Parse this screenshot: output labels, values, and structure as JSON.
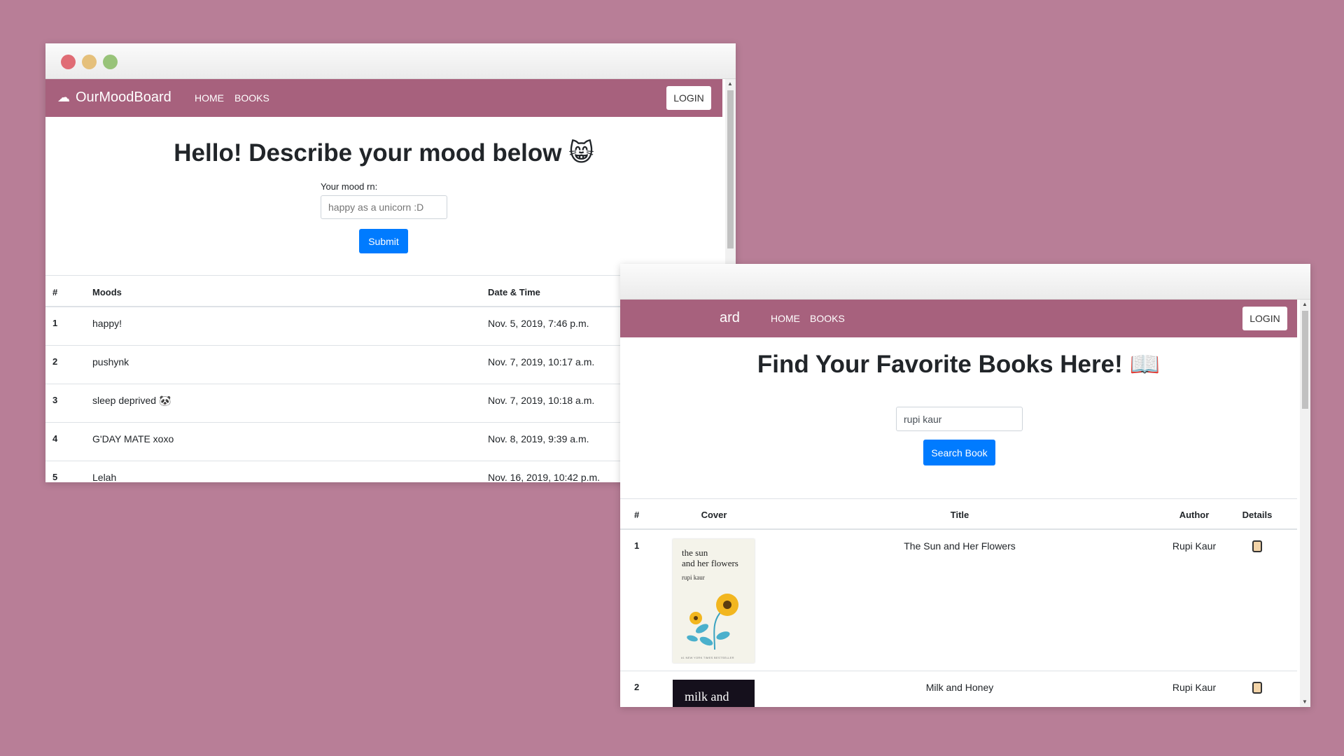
{
  "colors": {
    "background": "#b87e97",
    "navbar": "#a7617d",
    "primary": "#007bff",
    "close": "#e06c75",
    "minimize": "#e5c07b",
    "maximize": "#98c379"
  },
  "mood_window": {
    "brand_icon": "cloud-icon",
    "brand": "OurMoodBoard",
    "nav": {
      "home": "HOME",
      "books": "BOOKS"
    },
    "login": "LOGIN",
    "heading": "Hello! Describe your mood below",
    "heading_emoji": "😸",
    "form_label": "Your mood rn:",
    "input_placeholder": "happy as a unicorn :D",
    "submit": "Submit",
    "columns": {
      "num": "#",
      "moods": "Moods",
      "datetime": "Date & Time"
    },
    "rows": [
      {
        "num": "1",
        "mood": "happy!",
        "datetime": "Nov. 5, 2019, 7:46 p.m.",
        "action_icon": "sparkle-icon"
      },
      {
        "num": "2",
        "mood": "pushynk",
        "datetime": "Nov. 7, 2019, 10:17 a.m.",
        "action_icon": "sparkle-icon"
      },
      {
        "num": "3",
        "mood": "sleep deprived 🐼",
        "datetime": "Nov. 7, 2019, 10:18 a.m.",
        "action_icon": "sparkle-icon"
      },
      {
        "num": "4",
        "mood": "G'DAY MATE xoxo",
        "datetime": "Nov. 8, 2019, 9:39 a.m.",
        "action_icon": "sparkle-icon"
      },
      {
        "num": "5",
        "mood": "Lelah",
        "datetime": "Nov. 16, 2019, 10:42 p.m.",
        "action_icon": "sparkle-icon"
      }
    ]
  },
  "books_window": {
    "brand_partial": "ard",
    "nav": {
      "home": "HOME",
      "books": "BOOKS"
    },
    "login": "LOGIN",
    "heading": "Find Your Favorite Books Here!",
    "heading_emoji": "📖",
    "search_value": "rupi kaur",
    "search_button": "Search Book",
    "columns": {
      "num": "#",
      "cover": "Cover",
      "title": "Title",
      "author": "Author",
      "details": "Details"
    },
    "rows": [
      {
        "num": "1",
        "title": "The Sun and Her Flowers",
        "author": "Rupi Kaur",
        "details_icon": "scroll-icon",
        "cover": {
          "title_line1": "the sun",
          "title_line2": "and her flowers",
          "author": "rupi kaur",
          "tagline": "#1 NEW YORK TIMES BESTSELLER"
        }
      },
      {
        "num": "2",
        "title": "Milk and Honey",
        "author": "Rupi Kaur",
        "details_icon": "scroll-icon",
        "cover": {
          "title_line1": "milk and"
        }
      }
    ]
  }
}
